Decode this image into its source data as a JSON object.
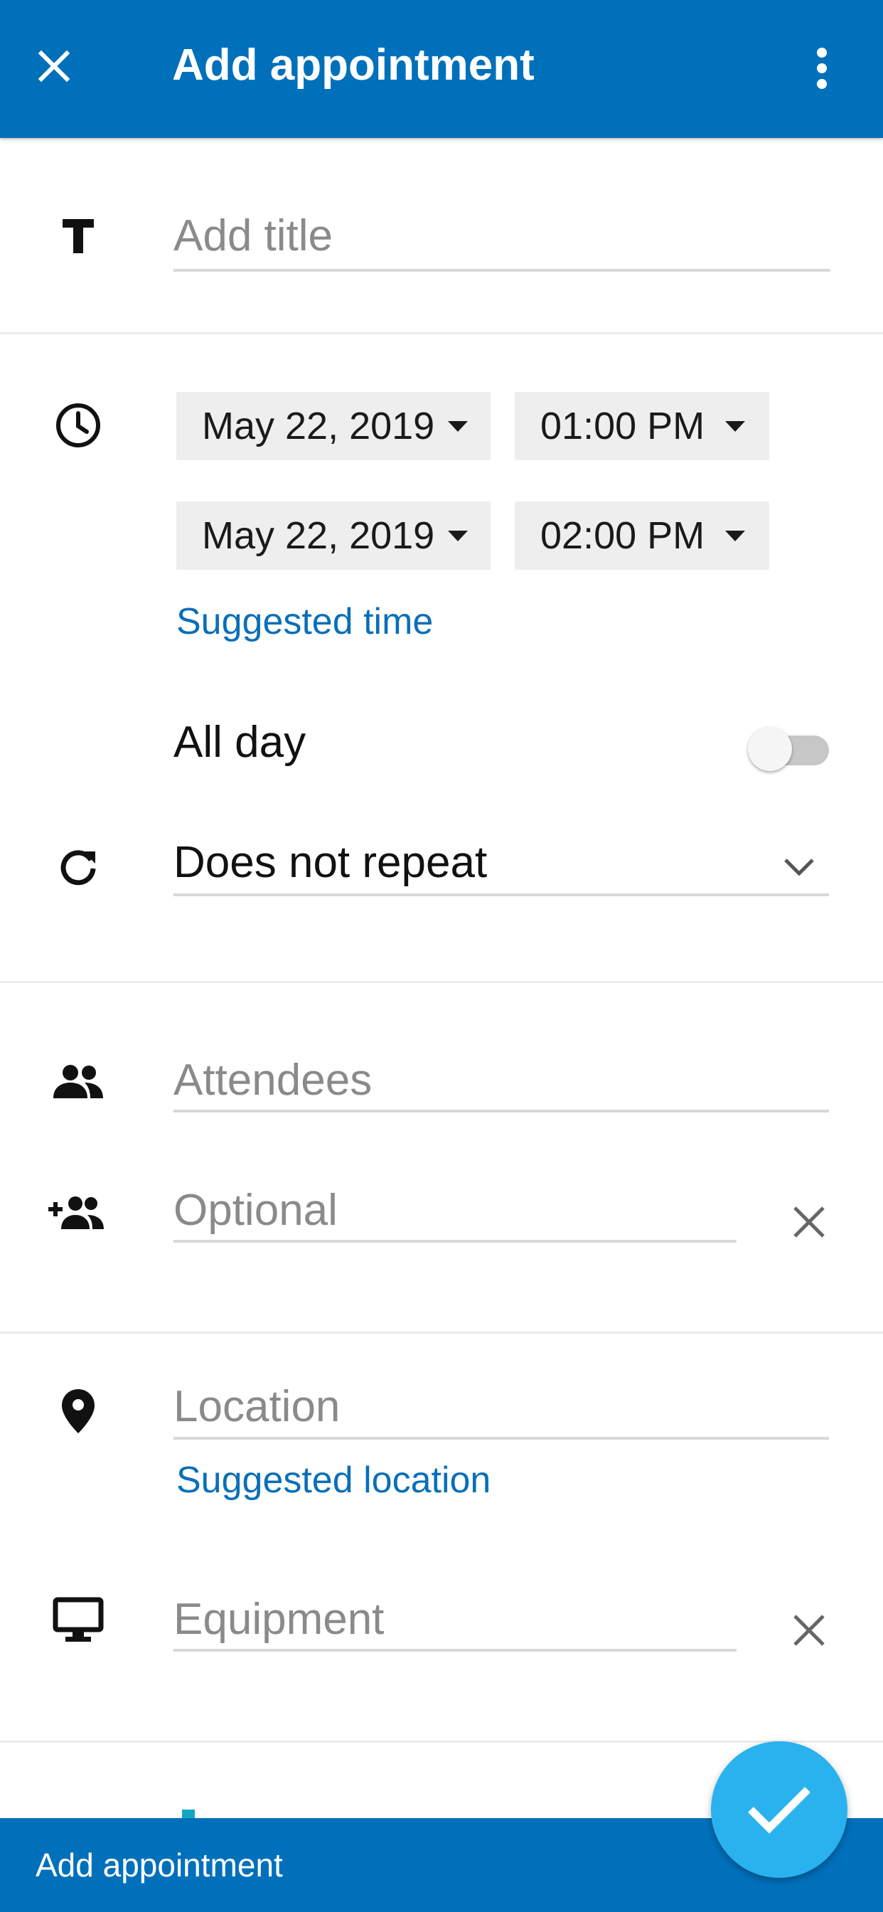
{
  "app_bar": {
    "title": "Add appointment",
    "close_icon": "close-icon",
    "more_icon": "more-vert-icon"
  },
  "title_field": {
    "icon": "title-icon",
    "placeholder": "Add title",
    "value": ""
  },
  "time": {
    "icon": "clock-icon",
    "start_date": "May 22, 2019",
    "start_time": "01:00 PM",
    "end_date": "May 22, 2019",
    "end_time": "02:00 PM",
    "suggested_time_link": "Suggested time"
  },
  "all_day": {
    "label": "All day",
    "checked": false
  },
  "repeat": {
    "icon": "refresh-icon",
    "value": "Does not repeat"
  },
  "attendees": {
    "icon": "people-icon",
    "placeholder": "Attendees"
  },
  "optional_attendees": {
    "icon": "group-add-icon",
    "placeholder": "Optional"
  },
  "location": {
    "icon": "location-pin-icon",
    "placeholder": "Location",
    "suggested_location_link": "Suggested location"
  },
  "equipment": {
    "icon": "monitor-icon",
    "placeholder": "Equipment"
  },
  "bottom_bar": {
    "label": "Add appointment"
  },
  "fab": {
    "icon": "check-icon"
  },
  "colors": {
    "primary": "#0070bb",
    "accent": "#29b2ee",
    "link": "#0a6fb8"
  }
}
